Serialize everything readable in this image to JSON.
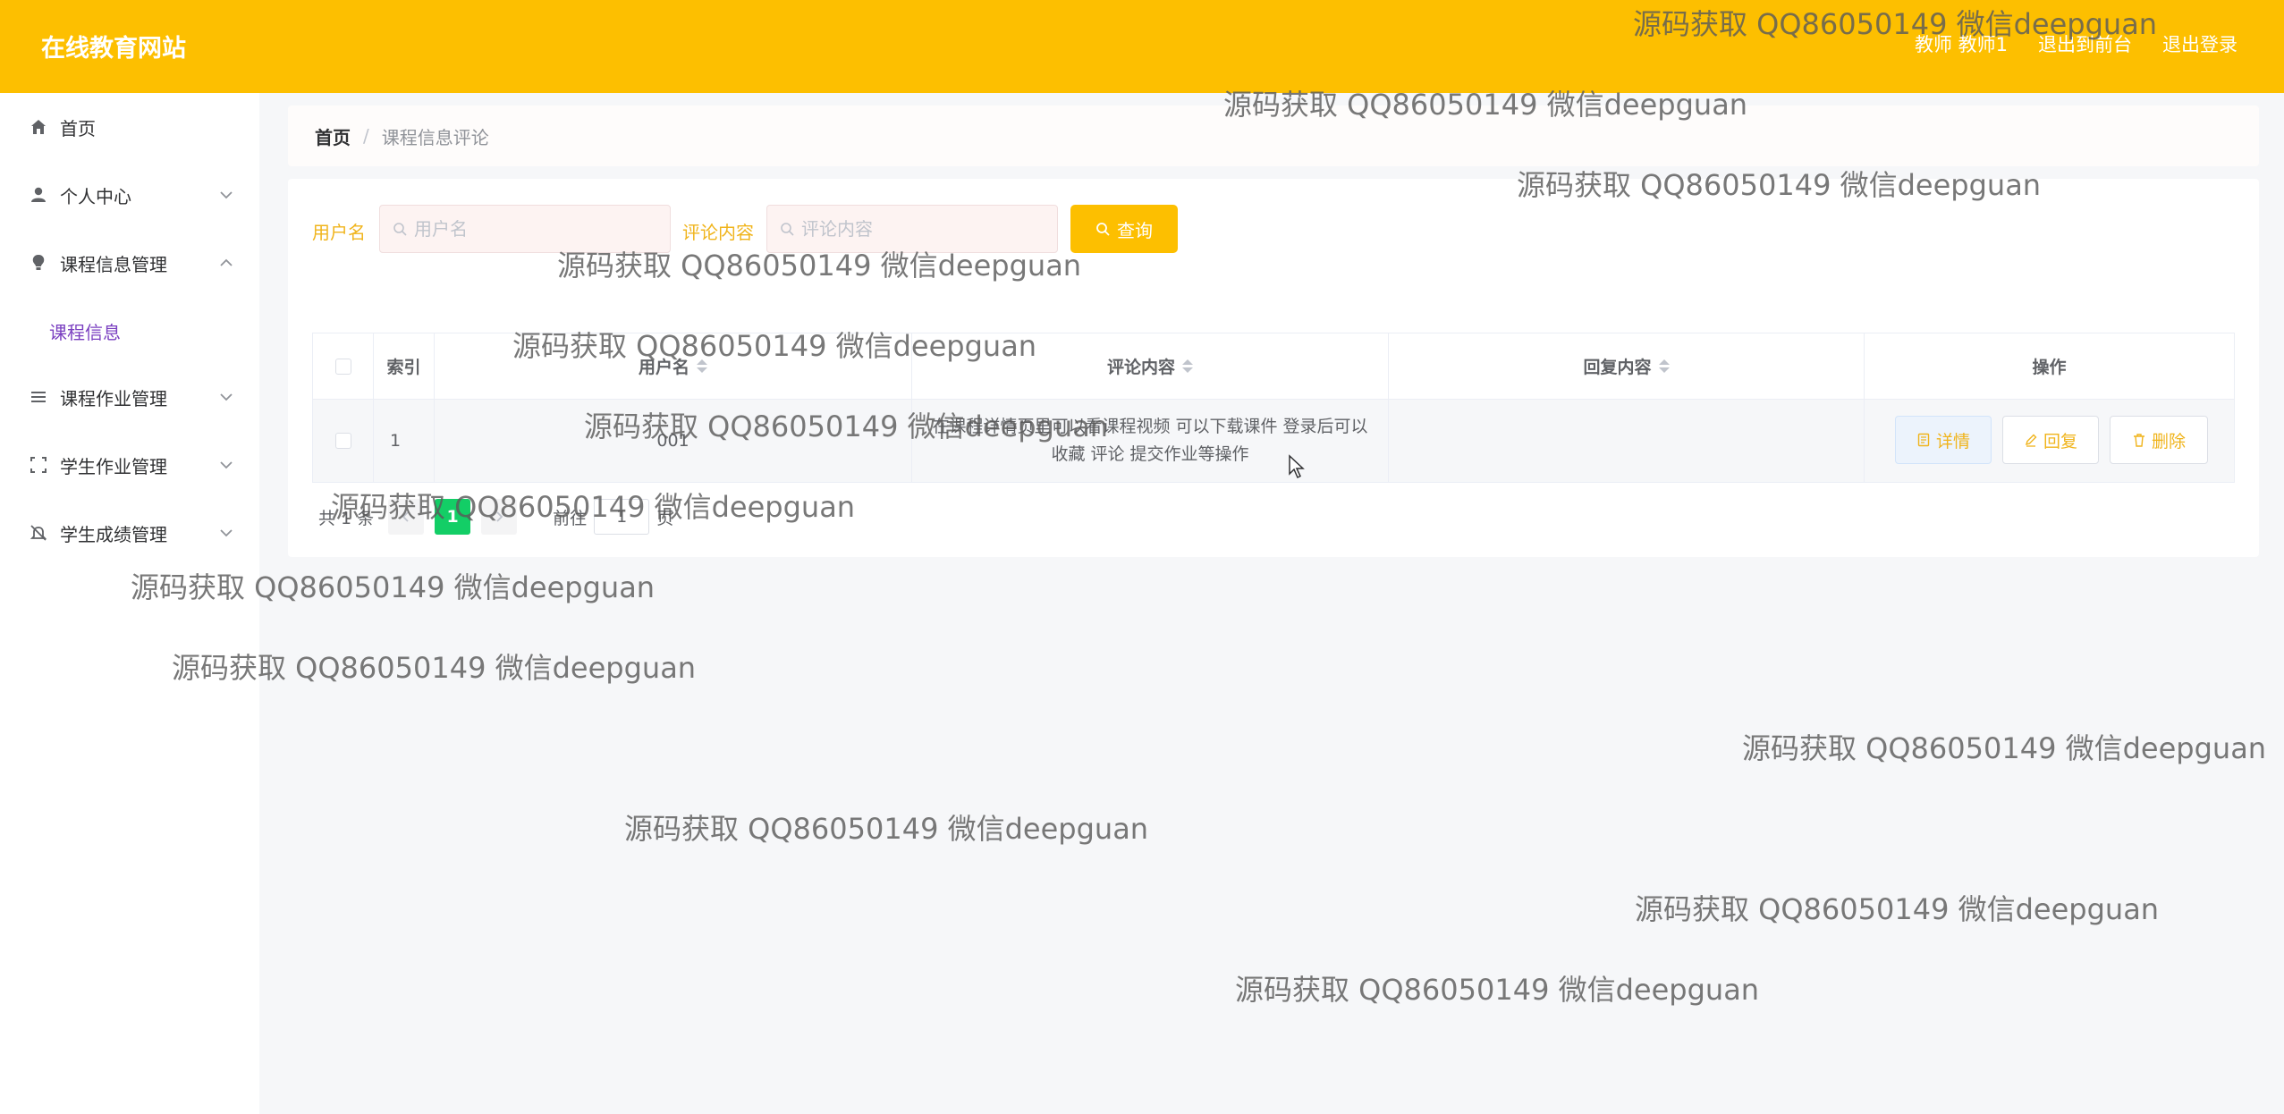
{
  "header": {
    "logo": "在线教育网站",
    "user": "教师 教师1",
    "front": "退出到前台",
    "logout": "退出登录"
  },
  "sidebar": {
    "items": [
      {
        "label": "首页",
        "icon": "home-icon"
      },
      {
        "label": "个人中心",
        "icon": "user-icon"
      },
      {
        "label": "课程信息管理",
        "icon": "bulb-icon"
      },
      {
        "label": "课程作业管理",
        "icon": "list-icon"
      },
      {
        "label": "学生作业管理",
        "icon": "scan-icon"
      },
      {
        "label": "学生成绩管理",
        "icon": "bell-off-icon"
      }
    ],
    "active_sub": "课程信息"
  },
  "breadcrumb": {
    "home": "首页",
    "sep": "/",
    "current": "课程信息评论"
  },
  "search": {
    "username_label": "用户名",
    "username_placeholder": "用户名",
    "comment_label": "评论内容",
    "comment_placeholder": "评论内容",
    "query_label": "查询"
  },
  "table": {
    "headers": {
      "index": "索引",
      "username": "用户名",
      "comment": "评论内容",
      "reply": "回复内容",
      "actions": "操作"
    },
    "rows": [
      {
        "index": "1",
        "username": "001",
        "comment": "在课程详情页里可以看课程视频 可以下载课件 登录后可以收藏 评论 提交作业等操作",
        "reply": ""
      }
    ],
    "actions": {
      "detail": "详情",
      "reply": "回复",
      "delete": "删除"
    }
  },
  "pager": {
    "total": "共 1 条",
    "current": "1",
    "goto_prefix": "前往",
    "goto_value": "1",
    "goto_suffix": "页"
  },
  "watermark": "源码获取 QQ86050149 微信deepguan",
  "colors": {
    "header": "#fdbf00",
    "accent_text": "#f0b41c",
    "pager_active": "#13ce66",
    "submenu_active": "#7a3fc0"
  }
}
